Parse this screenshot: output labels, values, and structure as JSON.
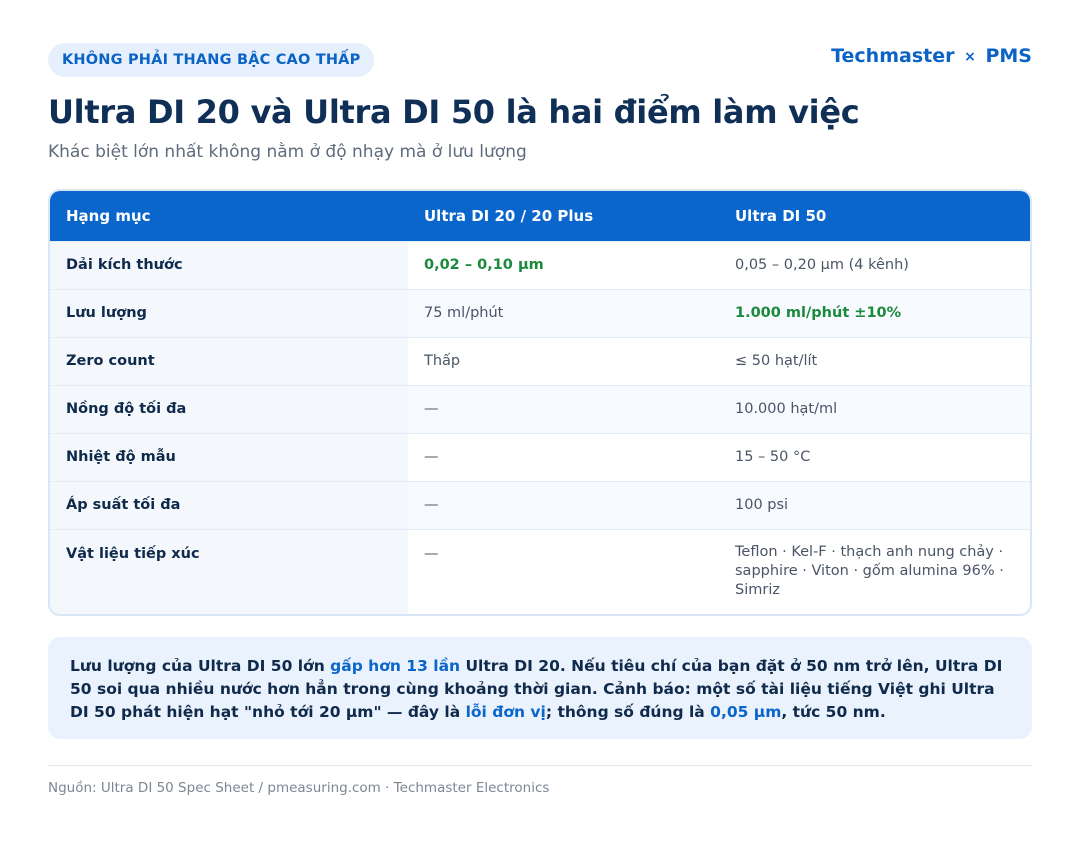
{
  "header": {
    "badge": "KHÔNG PHẢI THANG BẬC CAO THẤP",
    "brand_left": "Techmaster",
    "brand_sep": "×",
    "brand_right": "PMS",
    "title": "Ultra DI 20 và Ultra DI 50 là hai điểm làm việc",
    "subtitle": "Khác biệt lớn nhất không nằm ở độ nhạy mà ở lưu lượng"
  },
  "table": {
    "columns": [
      "Hạng mục",
      "Ultra DI 20 / 20 Plus",
      "Ultra DI 50"
    ],
    "rows": [
      {
        "label": "Dải kích thước",
        "di20": "0,02 – 0,10 µm",
        "di50": "0,05 – 0,20 µm (4 kênh)"
      },
      {
        "label": "Lưu lượng",
        "di20": "75 ml/phút",
        "di50": "1.000 ml/phút ±10%"
      },
      {
        "label": "Zero count",
        "di20": "Thấp",
        "di50": "≤ 50 hạt/lít"
      },
      {
        "label": "Nồng độ tối đa",
        "di20": "—",
        "di50": "10.000 hạt/ml"
      },
      {
        "label": "Nhiệt độ mẫu",
        "di20": "—",
        "di50": "15 – 50 °C"
      },
      {
        "label": "Áp suất tối đa",
        "di20": "—",
        "di50": "100 psi"
      },
      {
        "label": "Vật liệu tiếp xúc",
        "di20": "—",
        "di50": "Teflon · Kel-F · thạch anh nung chảy · sapphire · Viton · gốm alumina 96% · Simriz"
      }
    ],
    "highlight_color": "#1b8a3d"
  },
  "callout": {
    "p1": "Lưu lượng của Ultra DI 50 lớn ",
    "h1": "gấp hơn 13 lần",
    "p2": " Ultra DI 20. Nếu tiêu chí của bạn đặt ở 50 nm trở lên, Ultra DI 50 soi qua nhiều nước hơn hẳn trong cùng khoảng thời gian. Cảnh báo: một số tài liệu tiếng Việt ghi Ultra DI 50 phát hiện hạt \"nhỏ tới 20 µm\" — đây là ",
    "h2": "lỗi đơn vị",
    "p3": "; thông số đúng là ",
    "h3": "0,05 µm",
    "p4": ", tức 50 nm."
  },
  "footer": {
    "source": "Nguồn: Ultra DI 50 Spec Sheet / pmeasuring.com · Techmaster Electronics"
  },
  "colors": {
    "accent": "#0b66cc",
    "title": "#0f2f57",
    "callout_bg": "#eaf2fd"
  }
}
